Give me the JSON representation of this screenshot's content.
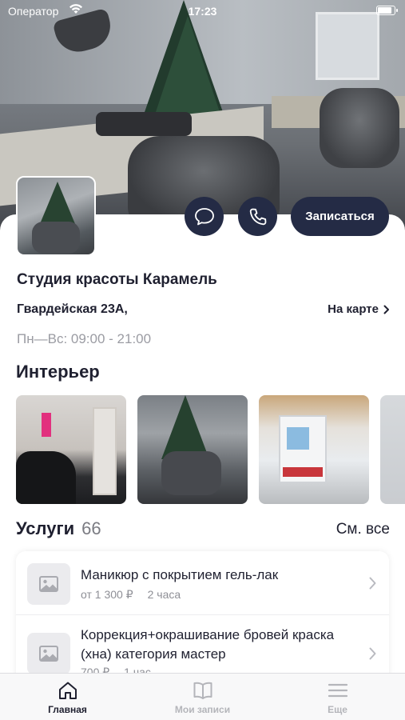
{
  "status_bar": {
    "carrier": "Оператор",
    "time": "17:23",
    "battery_level": 0.9
  },
  "actions": {
    "book_label": "Записаться",
    "message_icon": "chat-bubble-icon",
    "call_icon": "phone-icon"
  },
  "salon": {
    "name": "Студия красоты Карамель",
    "address": "Гвардейская 23А,",
    "map_link": "На карте",
    "hours": "Пн—Вс: 09:00 - 21:00"
  },
  "interior": {
    "heading": "Интерьер",
    "photo_count_visible": 4
  },
  "services": {
    "heading": "Услуги",
    "count": "66",
    "see_all": "См. все",
    "items": [
      {
        "name": "Маникюр с покрытием гель-лак",
        "price": "от 1 300 ₽",
        "duration": "2 часа"
      },
      {
        "name": "Коррекция+окрашивание бровей краска (хна) категория мастер",
        "price": "700 ₽",
        "duration": "1 час"
      }
    ]
  },
  "tabbar": {
    "items": [
      {
        "label": "Главная",
        "icon": "home-icon",
        "active": true
      },
      {
        "label": "Мои записи",
        "icon": "book-icon",
        "active": false
      },
      {
        "label": "Еще",
        "icon": "menu-icon",
        "active": false
      }
    ]
  },
  "colors": {
    "primary": "#242b45",
    "text": "#1f2030",
    "muted": "#9b9ca3",
    "tab_inactive": "#b4b5ba"
  }
}
